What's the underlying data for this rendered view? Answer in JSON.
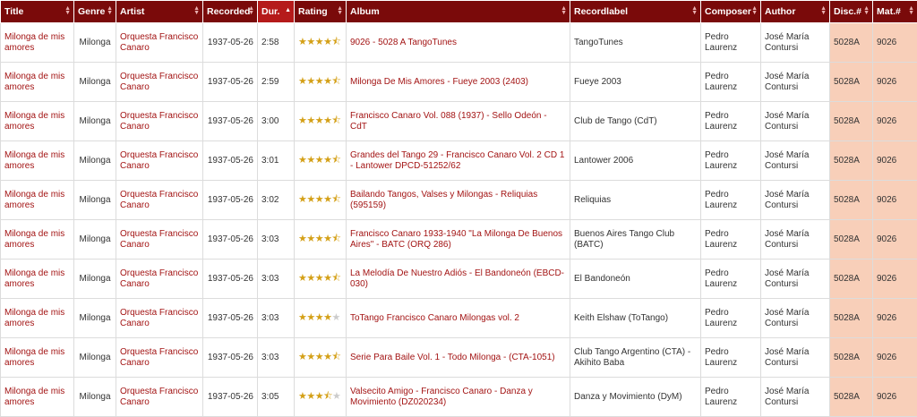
{
  "columns": [
    {
      "key": "title",
      "label": "Title"
    },
    {
      "key": "genre",
      "label": "Genre"
    },
    {
      "key": "artist",
      "label": "Artist"
    },
    {
      "key": "recorded",
      "label": "Recorded"
    },
    {
      "key": "duration",
      "label": "Dur."
    },
    {
      "key": "rating",
      "label": "Rating"
    },
    {
      "key": "album",
      "label": "Album"
    },
    {
      "key": "recordlabel",
      "label": "Recordlabel"
    },
    {
      "key": "composer",
      "label": "Composer"
    },
    {
      "key": "author",
      "label": "Author"
    },
    {
      "key": "disc",
      "label": "Disc.#"
    },
    {
      "key": "mat",
      "label": "Mat.#"
    }
  ],
  "sorted_column": "duration",
  "colors": {
    "header": "#7a0a0a",
    "link": "#a31414",
    "duration_bg": "#b9e7b0",
    "disc_bg": "#f8cfb9",
    "star": "#d4a017"
  },
  "rows": [
    {
      "title": "Milonga de mis amores",
      "genre": "Milonga",
      "artist": "Orquesta Francisco Canaro",
      "recorded": "1937-05-26",
      "duration": "2:58",
      "rating": 4.5,
      "album": "9026 - 5028 A TangoTunes",
      "recordlabel": "TangoTunes",
      "composer": "Pedro Laurenz",
      "author": "José María Contursi",
      "disc": "5028A",
      "mat": "9026"
    },
    {
      "title": "Milonga de mis amores",
      "genre": "Milonga",
      "artist": "Orquesta Francisco Canaro",
      "recorded": "1937-05-26",
      "duration": "2:59",
      "rating": 4.5,
      "album": "Milonga De Mis Amores - Fueye 2003 (2403)",
      "recordlabel": "Fueye 2003",
      "composer": "Pedro Laurenz",
      "author": "José María Contursi",
      "disc": "5028A",
      "mat": "9026"
    },
    {
      "title": "Milonga de mis amores",
      "genre": "Milonga",
      "artist": "Orquesta Francisco Canaro",
      "recorded": "1937-05-26",
      "duration": "3:00",
      "rating": 4.5,
      "album": "Francisco Canaro Vol. 088 (1937) - Sello Odeón - CdT",
      "recordlabel": "Club de Tango (CdT)",
      "composer": "Pedro Laurenz",
      "author": "José María Contursi",
      "disc": "5028A",
      "mat": "9026"
    },
    {
      "title": "Milonga de mis amores",
      "genre": "Milonga",
      "artist": "Orquesta Francisco Canaro",
      "recorded": "1937-05-26",
      "duration": "3:01",
      "rating": 4.5,
      "album": "Grandes del Tango 29 - Francisco Canaro Vol. 2 CD 1 - Lantower DPCD-51252/62",
      "recordlabel": "Lantower 2006",
      "composer": "Pedro Laurenz",
      "author": "José María Contursi",
      "disc": "5028A",
      "mat": "9026"
    },
    {
      "title": "Milonga de mis amores",
      "genre": "Milonga",
      "artist": "Orquesta Francisco Canaro",
      "recorded": "1937-05-26",
      "duration": "3:02",
      "rating": 4.5,
      "album": "Bailando Tangos, Valses y Milongas - Reliquias (595159)",
      "recordlabel": "Reliquias",
      "composer": "Pedro Laurenz",
      "author": "José María Contursi",
      "disc": "5028A",
      "mat": "9026"
    },
    {
      "title": "Milonga de mis amores",
      "genre": "Milonga",
      "artist": "Orquesta Francisco Canaro",
      "recorded": "1937-05-26",
      "duration": "3:03",
      "rating": 4.5,
      "album": "Francisco Canaro 1933-1940 \"La Milonga De Buenos Aires\" - BATC (ORQ 286)",
      "recordlabel": "Buenos Aires Tango Club (BATC)",
      "composer": "Pedro Laurenz",
      "author": "José María Contursi",
      "disc": "5028A",
      "mat": "9026"
    },
    {
      "title": "Milonga de mis amores",
      "genre": "Milonga",
      "artist": "Orquesta Francisco Canaro",
      "recorded": "1937-05-26",
      "duration": "3:03",
      "rating": 4.5,
      "album": "La Melodía De Nuestro Adiós - El Bandoneón (EBCD-030)",
      "recordlabel": "El Bandoneón",
      "composer": "Pedro Laurenz",
      "author": "José María Contursi",
      "disc": "5028A",
      "mat": "9026"
    },
    {
      "title": "Milonga de mis amores",
      "genre": "Milonga",
      "artist": "Orquesta Francisco Canaro",
      "recorded": "1937-05-26",
      "duration": "3:03",
      "rating": 4,
      "album": "ToTango Francisco Canaro Milongas vol. 2",
      "recordlabel": "Keith Elshaw (ToTango)",
      "composer": "Pedro Laurenz",
      "author": "José María Contursi",
      "disc": "5028A",
      "mat": "9026"
    },
    {
      "title": "Milonga de mis amores",
      "genre": "Milonga",
      "artist": "Orquesta Francisco Canaro",
      "recorded": "1937-05-26",
      "duration": "3:03",
      "rating": 4.5,
      "album": "Serie Para Baile Vol. 1 - Todo Milonga - (CTA-1051)",
      "recordlabel": "Club Tango Argentino (CTA) - Akihito Baba",
      "composer": "Pedro Laurenz",
      "author": "José María Contursi",
      "disc": "5028A",
      "mat": "9026"
    },
    {
      "title": "Milonga de mis amores",
      "genre": "Milonga",
      "artist": "Orquesta Francisco Canaro",
      "recorded": "1937-05-26",
      "duration": "3:05",
      "rating": 3.5,
      "album": "Valsecito Amigo - Francisco Canaro - Danza y Movimiento (DZ020234)",
      "recordlabel": "Danza y Movimiento (DyM)",
      "composer": "Pedro Laurenz",
      "author": "José María Contursi",
      "disc": "5028A",
      "mat": "9026"
    }
  ]
}
